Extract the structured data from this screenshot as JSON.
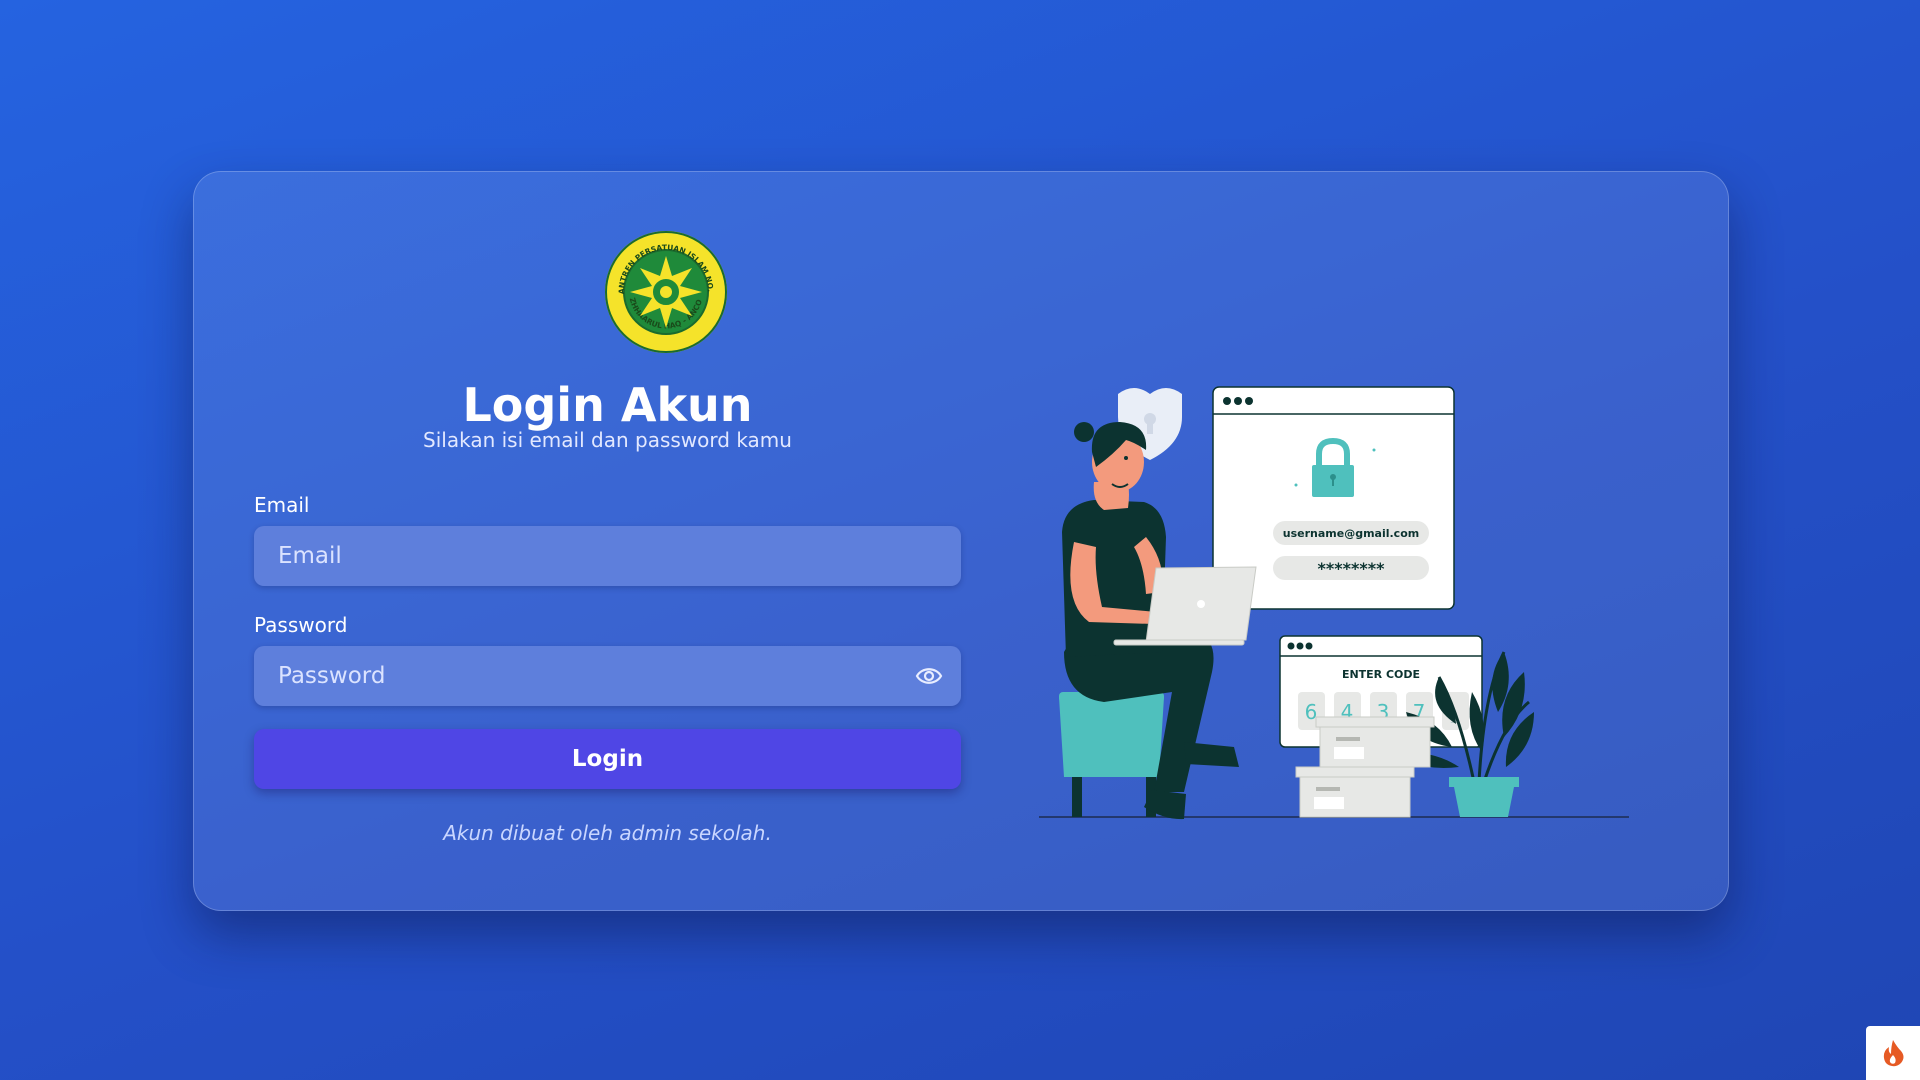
{
  "login": {
    "logo_text_top": "PESANTREN PERSATUAN ISLAM NO. 113",
    "logo_text_bottom": "IZHHAARUL HAQ - ANCOL",
    "title": "Login Akun",
    "subtitle": "Silakan isi email dan password kamu",
    "email_label": "Email",
    "email_placeholder": "Email",
    "email_value": "",
    "password_label": "Password",
    "password_placeholder": "Password",
    "password_value": "",
    "password_toggle_icon": "eye-icon",
    "login_button": "Login",
    "footnote": "Akun dibuat oleh admin sekolah."
  },
  "illustration": {
    "login_card_email": "username@gmail.com",
    "login_card_password": "********",
    "code_card_title": "ENTER CODE",
    "code_digits": [
      "6",
      "4",
      "3",
      "7",
      "_"
    ]
  },
  "fab": {
    "icon": "flame-icon"
  },
  "colors": {
    "background": "#2458d8",
    "card": "rgba(255,255,255,0.10)",
    "input": "#5e7fdc",
    "button": "#4f46e5",
    "accent_teal": "#4fc0bd",
    "dark_green": "#0c3330",
    "logo_yellow": "#f5e32a",
    "logo_green": "#1f8a3a"
  }
}
